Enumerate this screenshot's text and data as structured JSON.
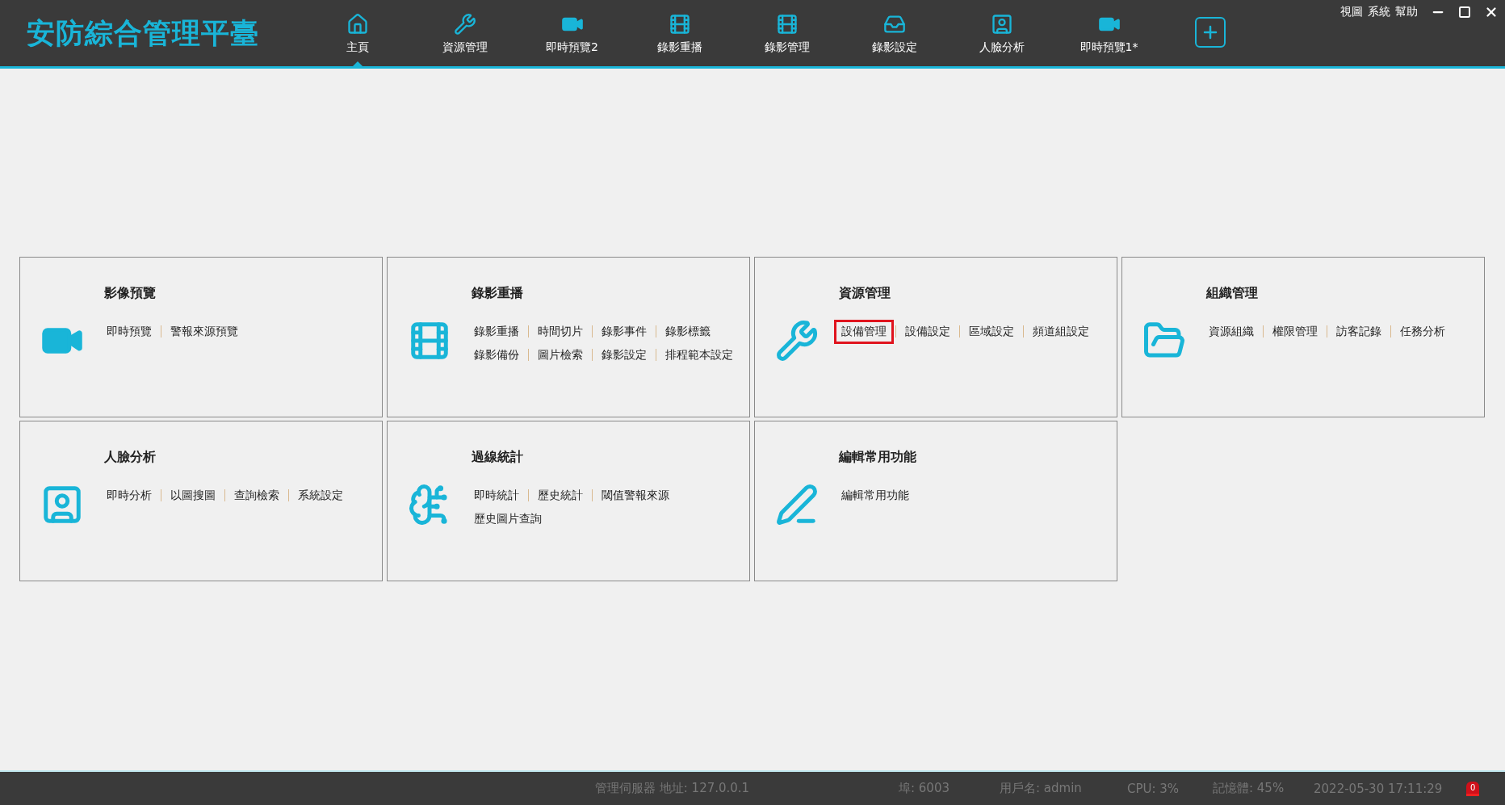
{
  "app_title": "安防綜合管理平臺",
  "nav": [
    {
      "label": "主頁",
      "selected": true
    },
    {
      "label": "資源管理",
      "selected": false
    },
    {
      "label": "即時預覽2",
      "selected": false
    },
    {
      "label": "錄影重播",
      "selected": false
    },
    {
      "label": "錄影管理",
      "selected": false
    },
    {
      "label": "錄影設定",
      "selected": false
    },
    {
      "label": "人臉分析",
      "selected": false
    },
    {
      "label": "即時預覽1*",
      "selected": false
    }
  ],
  "menu": [
    "視圖",
    "系統",
    "幫助"
  ],
  "cards": [
    {
      "title": "影像預覽",
      "rows": [
        [
          {
            "label": "即時預覽",
            "highlighted": false
          },
          {
            "label": "警報來源預覽",
            "highlighted": false
          }
        ]
      ]
    },
    {
      "title": "錄影重播",
      "rows": [
        [
          {
            "label": "錄影重播",
            "highlighted": false
          },
          {
            "label": "時間切片",
            "highlighted": false
          },
          {
            "label": "錄影事件",
            "highlighted": false
          },
          {
            "label": "錄影標籤",
            "highlighted": false
          }
        ],
        [
          {
            "label": "錄影備份",
            "highlighted": false
          },
          {
            "label": "圖片檢索",
            "highlighted": false
          },
          {
            "label": "錄影設定",
            "highlighted": false
          },
          {
            "label": "排程範本設定",
            "highlighted": false
          }
        ]
      ]
    },
    {
      "title": "資源管理",
      "rows": [
        [
          {
            "label": "設備管理",
            "highlighted": true
          },
          {
            "label": "設備設定",
            "highlighted": false
          },
          {
            "label": "區域設定",
            "highlighted": false
          },
          {
            "label": "頻道組設定",
            "highlighted": false
          }
        ]
      ]
    },
    {
      "title": "組織管理",
      "rows": [
        [
          {
            "label": "資源組織",
            "highlighted": false
          },
          {
            "label": "權限管理",
            "highlighted": false
          },
          {
            "label": "訪客記錄",
            "highlighted": false
          },
          {
            "label": "任務分析",
            "highlighted": false
          }
        ]
      ]
    },
    {
      "title": "人臉分析",
      "rows": [
        [
          {
            "label": "即時分析",
            "highlighted": false
          },
          {
            "label": "以圖搜圖",
            "highlighted": false
          },
          {
            "label": "查詢檢索",
            "highlighted": false
          },
          {
            "label": "系統設定",
            "highlighted": false
          }
        ]
      ]
    },
    {
      "title": "過線統計",
      "rows": [
        [
          {
            "label": "即時統計",
            "highlighted": false
          },
          {
            "label": "歷史統計",
            "highlighted": false
          },
          {
            "label": "閾值警報來源",
            "highlighted": false
          }
        ],
        [
          {
            "label": "歷史圖片查詢",
            "highlighted": false
          }
        ]
      ]
    },
    {
      "title": "編輯常用功能",
      "rows": [
        [
          {
            "label": "編輯常用功能",
            "highlighted": false
          }
        ]
      ]
    }
  ],
  "status_bar": {
    "server": "管理伺服器 地址: 127.0.0.1",
    "port": "埠: 6003",
    "user": "用戶名: admin",
    "cpu": "CPU: 3%",
    "memory": "記憶體: 45%",
    "datetime": "2022-05-30 17:11:29",
    "alarm_count": "0"
  }
}
